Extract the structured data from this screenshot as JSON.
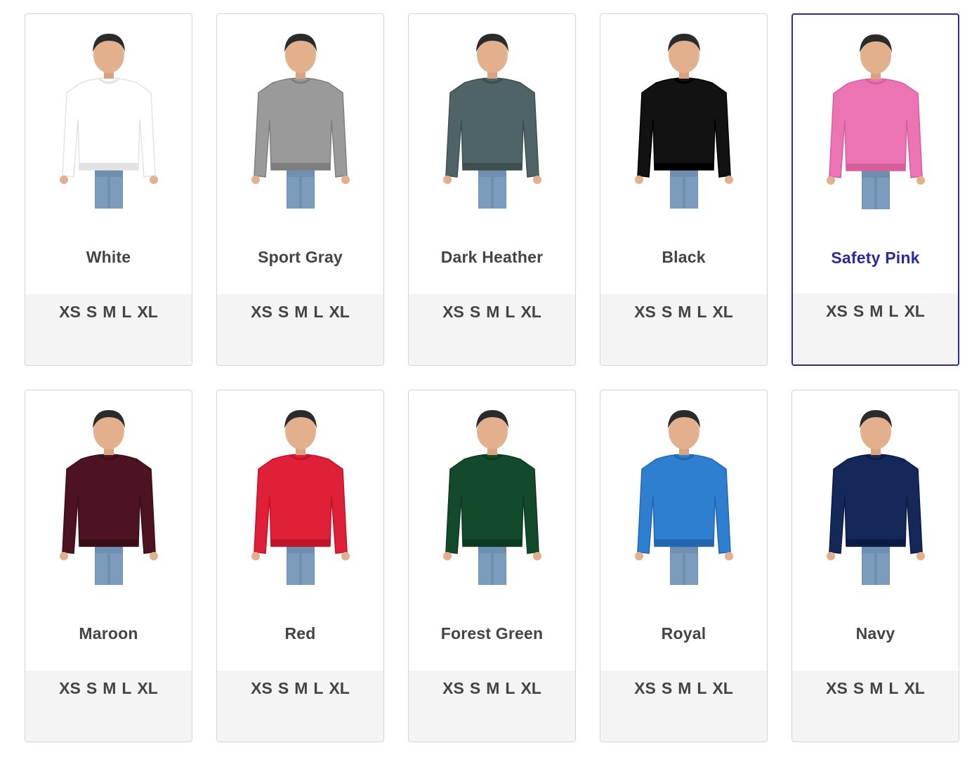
{
  "swatches": [
    {
      "name": "White",
      "color": "#ffffff",
      "shade": "#e3e3e3",
      "sizes": [
        "XS",
        "S",
        "M",
        "L",
        "XL"
      ],
      "selected": false
    },
    {
      "name": "Sport Gray",
      "color": "#9a9a9a",
      "shade": "#7e7e7e",
      "sizes": [
        "XS",
        "S",
        "M",
        "L",
        "XL"
      ],
      "selected": false
    },
    {
      "name": "Dark Heather",
      "color": "#4f6466",
      "shade": "#3d4f51",
      "sizes": [
        "XS",
        "S",
        "M",
        "L",
        "XL"
      ],
      "selected": false
    },
    {
      "name": "Black",
      "color": "#121212",
      "shade": "#000000",
      "sizes": [
        "XS",
        "S",
        "M",
        "L",
        "XL"
      ],
      "selected": false
    },
    {
      "name": "Safety Pink",
      "color": "#ec74b4",
      "shade": "#d65e9c",
      "sizes": [
        "XS",
        "S",
        "M",
        "L",
        "XL"
      ],
      "selected": true
    },
    {
      "name": "Maroon",
      "color": "#4e1322",
      "shade": "#3b0d18",
      "sizes": [
        "XS",
        "S",
        "M",
        "L",
        "XL"
      ],
      "selected": false
    },
    {
      "name": "Red",
      "color": "#e01f38",
      "shade": "#bf1429",
      "sizes": [
        "XS",
        "S",
        "M",
        "L",
        "XL"
      ],
      "selected": false
    },
    {
      "name": "Forest Green",
      "color": "#124a2b",
      "shade": "#0a3a20",
      "sizes": [
        "XS",
        "S",
        "M",
        "L",
        "XL"
      ],
      "selected": false
    },
    {
      "name": "Royal",
      "color": "#2f7fd1",
      "shade": "#2266b0",
      "sizes": [
        "XS",
        "S",
        "M",
        "L",
        "XL"
      ],
      "selected": false
    },
    {
      "name": "Navy",
      "color": "#14285a",
      "shade": "#0c1b44",
      "sizes": [
        "XS",
        "S",
        "M",
        "L",
        "XL"
      ],
      "selected": false
    }
  ]
}
